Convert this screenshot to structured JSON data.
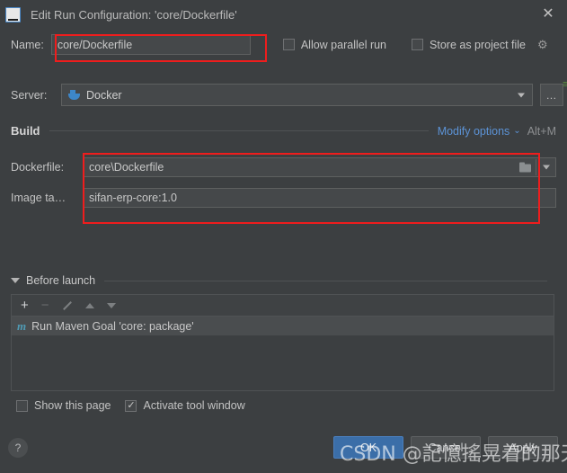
{
  "window": {
    "title": "Edit Run Configuration: 'core/Dockerfile'",
    "logo_text": "IJ",
    "close_glyph": "✕"
  },
  "name_row": {
    "label": "Name:",
    "value": "core/Dockerfile",
    "allow_parallel_run": {
      "label": "Allow parallel run",
      "checked": false
    },
    "store_as_project_file": {
      "label": "Store as project file",
      "checked": false
    }
  },
  "server_row": {
    "label": "Server:",
    "value": "Docker",
    "more_button": "…"
  },
  "build": {
    "section_title": "Build",
    "modify_options": "Modify options",
    "modify_shortcut": "Alt+M",
    "dockerfile": {
      "label": "Dockerfile:",
      "value": "core\\Dockerfile"
    },
    "image_tag": {
      "label": "Image ta…",
      "value": "sifan-erp-core:1.0"
    }
  },
  "before_launch": {
    "title": "Before launch",
    "toolbar": {
      "add": "+",
      "remove": "−",
      "edit": "edit-pencil",
      "move_up": "move-up",
      "move_down": "move-down"
    },
    "items": [
      {
        "icon": "m",
        "text": "Run Maven Goal 'core: package'"
      }
    ]
  },
  "bottom": {
    "show_this_page": {
      "label": "Show this page",
      "checked": false
    },
    "activate_tool_window": {
      "label": "Activate tool window",
      "checked": true
    },
    "help": "?",
    "buttons": [
      {
        "label": "OK",
        "primary": true
      },
      {
        "label": "Cancel",
        "primary": false
      },
      {
        "label": "Apply",
        "primary": false
      }
    ]
  },
  "watermark": "CSDN @記憶搖晃着的那天",
  "colors": {
    "background": "#3c3f41",
    "field_background": "#45484a",
    "accent_link": "#5c93d6",
    "primary_button": "#3b6ea8",
    "annotation_red": "#ef1d1d",
    "maven_icon": "#4f9bb5",
    "docker_blue": "#3d87c9"
  }
}
